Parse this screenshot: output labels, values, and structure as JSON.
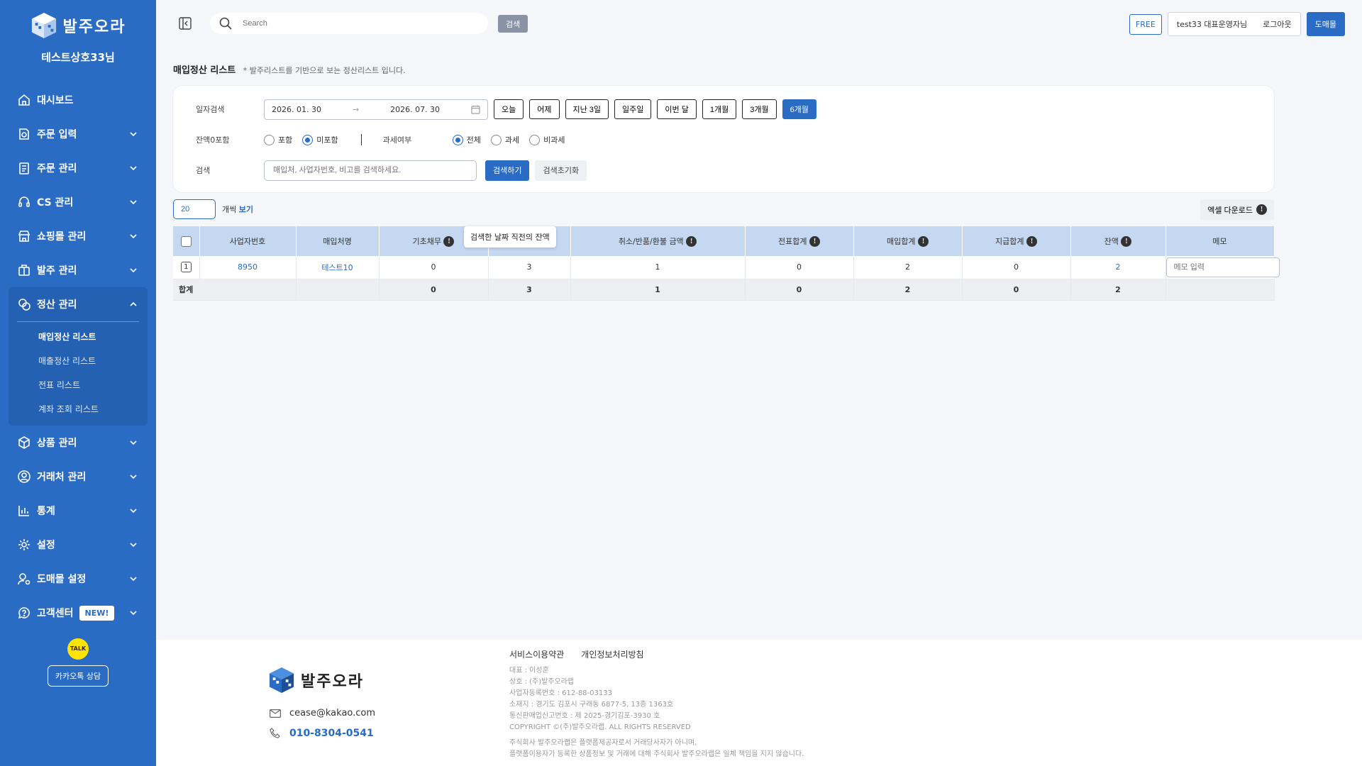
{
  "brand": {
    "name": "발주오라",
    "shop_name": "테스트상호33님"
  },
  "sidebar": {
    "items": [
      {
        "label": "대시보드",
        "icon": "home-icon"
      },
      {
        "label": "주문 입력",
        "icon": "order-input-icon"
      },
      {
        "label": "주문 관리",
        "icon": "clipboard-icon"
      },
      {
        "label": "CS 관리",
        "icon": "headset-icon"
      },
      {
        "label": "쇼핑몰 관리",
        "icon": "store-icon"
      },
      {
        "label": "발주 관리",
        "icon": "box-icon"
      },
      {
        "label": "정산 관리",
        "icon": "settlement-icon"
      },
      {
        "label": "상품 관리",
        "icon": "package-icon"
      },
      {
        "label": "거래처 관리",
        "icon": "user-circle-icon"
      },
      {
        "label": "통계",
        "icon": "bar-chart-icon"
      },
      {
        "label": "설정",
        "icon": "gear-icon"
      },
      {
        "label": "도매몰 설정",
        "icon": "user-settings-icon"
      },
      {
        "label": "고객센터",
        "icon": "chat-icon"
      }
    ],
    "submenu": [
      "매입정산 리스트",
      "매출정산 리스트",
      "전표 리스트",
      "계좌 조회 리스트"
    ],
    "new_badge": "NEW!",
    "kakao_talk": "TALK",
    "kakao_button": "카카오톡 상담"
  },
  "topbar": {
    "search_placeholder": "Search",
    "search_button": "검색",
    "plan_badge": "FREE",
    "user_name": "test33 대표운영자님",
    "logout": "로그아웃",
    "wholesale_button": "도매몰"
  },
  "page": {
    "title": "매입정산 리스트",
    "subtitle": "* 발주리스트를 기반으로 보는 정산리스트 입니다."
  },
  "filter": {
    "date_label": "일자검색",
    "date_from": "2026. 01. 30",
    "date_arrow": "→",
    "date_to": "2026. 07. 30",
    "date_buttons": [
      "오늘",
      "어제",
      "지난 3일",
      "일주일",
      "이번 달",
      "1개월",
      "3개월",
      "6개월"
    ],
    "active_date_button": "6개월",
    "balance_label": "잔액0포함",
    "balance_options": [
      "포함",
      "미포함"
    ],
    "balance_selected": "미포함",
    "tax_label": "과세여부",
    "tax_options": [
      "전체",
      "과세",
      "비과세"
    ],
    "tax_selected": "전체",
    "keyword_label": "검색",
    "keyword_placeholder": "매입처, 사업자번호, 비고를 검색하세요.",
    "search_button": "검색하기",
    "reset_button": "검색초기화"
  },
  "list": {
    "page_size": "20",
    "page_size_suffix": "개씩",
    "page_size_view": "보기",
    "excel_button": "엑셀 다운로드",
    "tooltip": "검색한 날짜 직전의 잔액",
    "columns": [
      "사업자번호",
      "매입처명",
      "기초채무",
      "",
      "취소/반품/환불 금액",
      "전표합계",
      "매입합계",
      "지급합계",
      "잔액",
      "메모"
    ],
    "info_icon": "!",
    "rows": [
      {
        "num": "1",
        "biz_no": "8950",
        "vendor": "테스트10",
        "opening": "0",
        "col4": "3",
        "refund": "1",
        "voucher": "0",
        "purchase": "2",
        "paid": "0",
        "balance": "2",
        "memo_placeholder": "메모 입력"
      }
    ],
    "total": {
      "label": "합계",
      "opening": "0",
      "col4": "3",
      "refund": "1",
      "voucher": "0",
      "purchase": "2",
      "paid": "0",
      "balance": "2"
    }
  },
  "footer": {
    "links": [
      "서비스이용약관",
      "개인정보처리방침"
    ],
    "info": [
      "대표 : 이성훈",
      "상호 : (주)발주오라랩",
      "사업자등록번호 : 612-88-03133",
      "소재지 : 경기도 김포시 구래동 6877-5, 13층 1363호",
      "통신판매업신고번호 : 제 2025-경기김포-3930 호",
      "COPYRIGHT ©(주)발주오라랩. ALL RIGHTS RESERVED"
    ],
    "notice": [
      "주식회사 발주오라랩은 플랫폼제공자로서 거래당사자가 아니며,",
      "플랫폼이용자가 등록한 상품정보 및 거래에 대해 주식회사 발주오라랩은 일체 책임을 지지 않습니다."
    ],
    "email": "cease@kakao.com",
    "phone": "010-8304-0541"
  },
  "colors": {
    "primary": "#2a6bc4",
    "header_bg": "#c5d8f1",
    "sidebar_bg": "#2a6bc4"
  }
}
